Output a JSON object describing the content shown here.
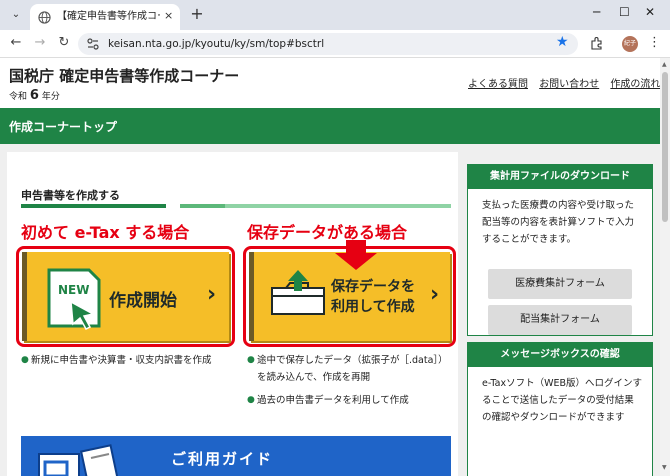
{
  "browser": {
    "tab_title": "【確定申告書等作成コーナー】-作成",
    "close_glyph": "×",
    "new_tab_glyph": "+",
    "url": "keisan.nta.go.jp/kyoutu/ky/sm/top#bsctrl",
    "profile_label": "紀子"
  },
  "header": {
    "site_title": "国税庁 確定申告書等作成コーナー",
    "era": "令和",
    "year_num": "6",
    "year_unit": "年分",
    "links": [
      "よくある質問",
      "お問い合わせ",
      "作成の流れ"
    ]
  },
  "nav": {
    "section_title": "作成コーナートップ"
  },
  "main": {
    "section_heading": "申告書等を作成する",
    "label_first": "初めて e-Tax する場合",
    "label_saved": "保存データがある場合",
    "btn_start": "作成開始",
    "btn_resume_line1": "保存データを",
    "btn_resume_line2": "利用して作成",
    "chevron": "›",
    "new_badge": "NEW",
    "notes_left": [
      "新規に申告書や決算書・収支内訳書を作成"
    ],
    "notes_right": [
      "途中で保存したデータ（拡張子が［.data］）を読み込んで、作成を再開",
      "過去の申告書データを利用して作成"
    ],
    "guide_title": "ご利用ガイド"
  },
  "sidebar": {
    "download_title": "集計用ファイルのダウンロード",
    "download_text": "支払った医療費の内容や受け取った配当等の内容を表計算ソフトで入力することができます。",
    "medical_form": "医療費集計フォーム",
    "dividend_form": "配当集計フォーム",
    "message_title": "メッセージボックスの確認",
    "message_text": "e-Taxソフト（WEB版）へログインすることで送信したデータの受付結果の確認やダウンロードができます"
  },
  "colors": {
    "brand_green": "#1f8446",
    "card_yellow": "#f5be28",
    "highlight_red": "#e60012",
    "guide_blue": "#1f64c8"
  }
}
